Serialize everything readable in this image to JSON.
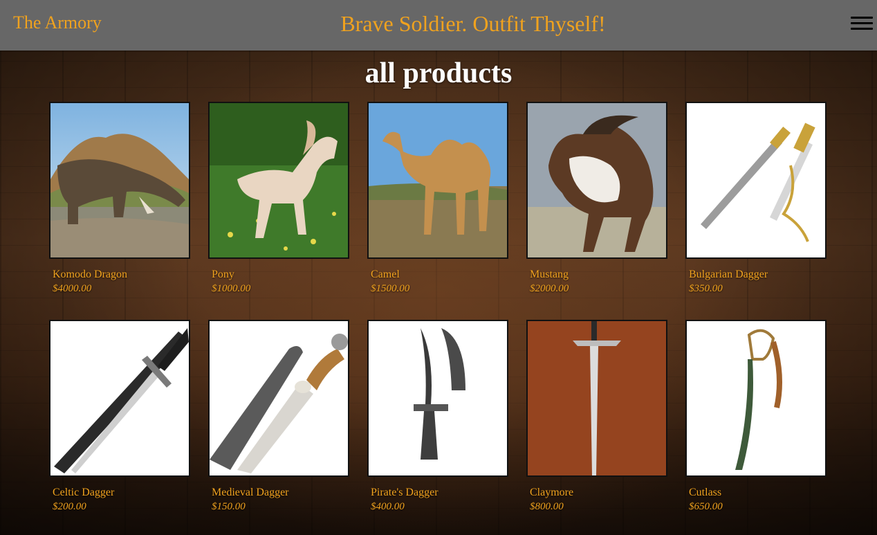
{
  "header": {
    "brand": "The Armory",
    "tagline": "Brave Soldier. Outfit Thyself!",
    "menu_icon": "hamburger-menu-icon"
  },
  "page": {
    "title": "all products"
  },
  "colors": {
    "accent": "#f0a21e",
    "header_bg": "#676767",
    "title": "#ffffff"
  },
  "products": [
    {
      "name": "Komodo Dragon",
      "price": "$4000.00",
      "image": "komodo-dragon-photo"
    },
    {
      "name": "Pony",
      "price": "$1000.00",
      "image": "pony-photo"
    },
    {
      "name": "Camel",
      "price": "$1500.00",
      "image": "camel-photo"
    },
    {
      "name": "Mustang",
      "price": "$2000.00",
      "image": "mustang-photo"
    },
    {
      "name": "Bulgarian Dagger",
      "price": "$350.00",
      "image": "bulgarian-dagger-photo"
    },
    {
      "name": "Celtic Dagger",
      "price": "$200.00",
      "image": "celtic-dagger-photo"
    },
    {
      "name": "Medieval Dagger",
      "price": "$150.00",
      "image": "medieval-dagger-photo"
    },
    {
      "name": "Pirate's Dagger",
      "price": "$400.00",
      "image": "pirates-dagger-photo"
    },
    {
      "name": "Claymore",
      "price": "$800.00",
      "image": "claymore-photo"
    },
    {
      "name": "Cutlass",
      "price": "$650.00",
      "image": "cutlass-photo"
    }
  ]
}
